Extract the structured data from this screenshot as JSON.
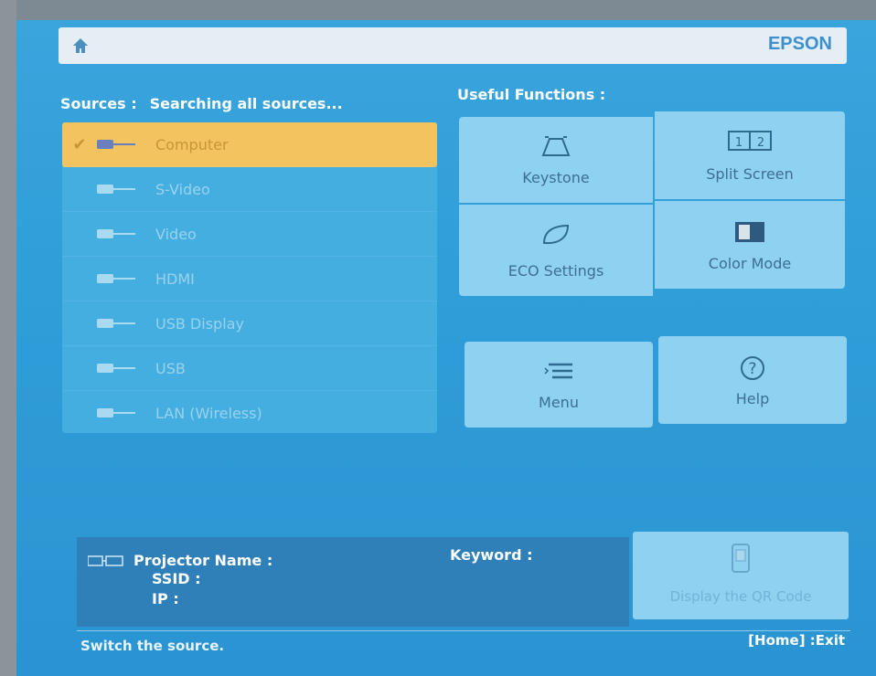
{
  "header": {
    "brand": "EPSON"
  },
  "sources": {
    "label": "Sources :",
    "status": "Searching all sources...",
    "items": [
      {
        "label": "Computer",
        "selected": true
      },
      {
        "label": "S-Video",
        "selected": false
      },
      {
        "label": "Video",
        "selected": false
      },
      {
        "label": "HDMI",
        "selected": false
      },
      {
        "label": "USB Display",
        "selected": false
      },
      {
        "label": "USB",
        "selected": false
      },
      {
        "label": "LAN (Wireless)",
        "selected": false
      }
    ]
  },
  "useful_functions": {
    "label": "Useful Functions :",
    "tiles": [
      {
        "label": "Keystone",
        "icon": "keystone-icon"
      },
      {
        "label": "Split Screen",
        "icon": "split-screen-icon"
      },
      {
        "label": "ECO Settings",
        "icon": "leaf-icon"
      },
      {
        "label": "Color Mode",
        "icon": "color-mode-icon"
      },
      {
        "label": "Menu",
        "icon": "menu-icon"
      },
      {
        "label": "Help",
        "icon": "help-icon"
      }
    ]
  },
  "network": {
    "projector_name": "Projector Name :",
    "ssid": "SSID :",
    "ip": "IP :",
    "keyword": "Keyword :",
    "qr_button": "Display the QR Code"
  },
  "footer": {
    "hint": "Switch the source.",
    "exit": "[Home] :Exit"
  },
  "colors": {
    "background": "#2f9ed9",
    "selected": "#f3c35f",
    "tile": "#8fd1f0"
  }
}
